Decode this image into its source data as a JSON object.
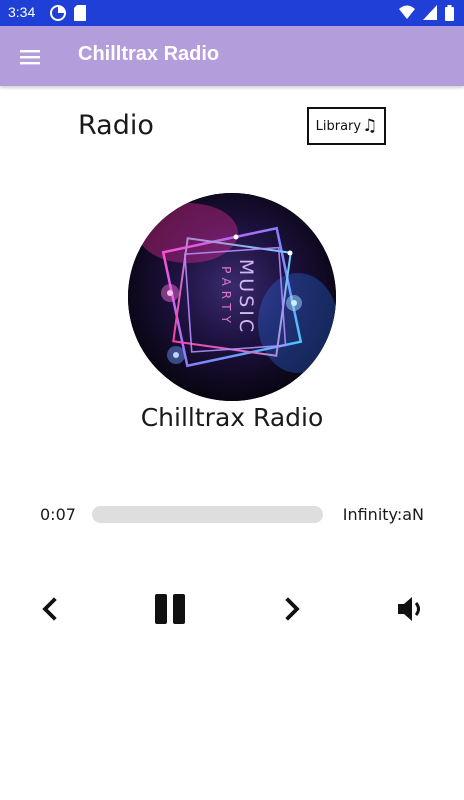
{
  "status_bar": {
    "time": "3:34"
  },
  "app_bar": {
    "title": "Chilltrax Radio"
  },
  "page": {
    "heading": "Radio",
    "library_label": "Library",
    "library_icon": "music-note-icon"
  },
  "album_art": {
    "text_line1": "MUSIC",
    "text_line2": "PARTY"
  },
  "player": {
    "station_name": "Chilltrax Radio",
    "current_time": "0:07",
    "duration": "Infinity:aN",
    "progress_fraction": 0
  },
  "colors": {
    "status_bar": "#1f3fd6",
    "app_bar": "#b39ddb",
    "track": "#dedede"
  }
}
